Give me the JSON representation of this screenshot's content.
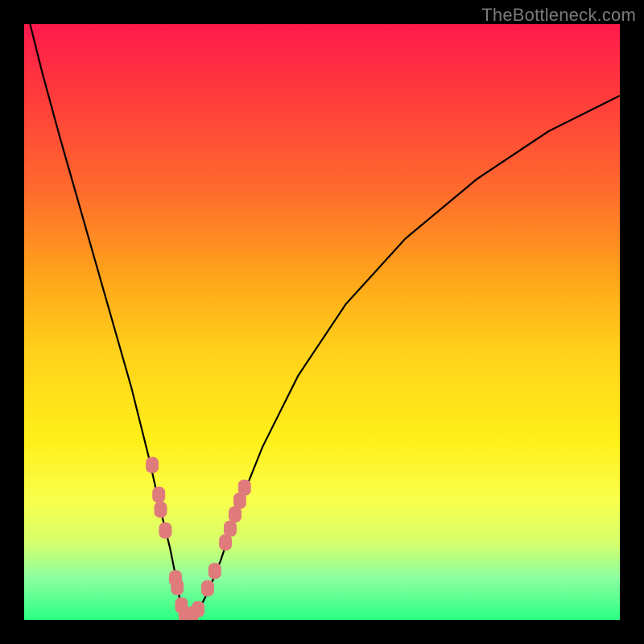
{
  "watermark": "TheBottleneck.com",
  "colors": {
    "frame": "#000000",
    "gradient_top": "#ff1a4d",
    "gradient_bottom": "#2bff84",
    "curve": "#000000",
    "marker": "#df7b7b"
  },
  "chart_data": {
    "type": "line",
    "title": "",
    "xlabel": "",
    "ylabel": "",
    "xlim": [
      0,
      100
    ],
    "ylim": [
      0,
      100
    ],
    "series": [
      {
        "name": "bottleneck-curve",
        "x": [
          1,
          3,
          6,
          10,
          14,
          18,
          21,
          23,
          24.5,
          25.5,
          26.2,
          27,
          28,
          29.5,
          31,
          33,
          36,
          40,
          46,
          54,
          64,
          76,
          88,
          100
        ],
        "y": [
          100,
          92,
          81,
          67,
          53,
          39,
          27,
          18,
          12,
          7,
          3,
          0.8,
          0.6,
          2,
          5,
          10,
          19,
          29,
          41,
          53,
          64,
          74,
          82,
          88
        ]
      }
    ],
    "markers": [
      {
        "x": 21.5,
        "y": 26
      },
      {
        "x": 22.6,
        "y": 21
      },
      {
        "x": 22.9,
        "y": 18.5
      },
      {
        "x": 23.7,
        "y": 15
      },
      {
        "x": 25.4,
        "y": 7
      },
      {
        "x": 25.7,
        "y": 5.5
      },
      {
        "x": 26.4,
        "y": 2.4
      },
      {
        "x": 27.0,
        "y": 0.9
      },
      {
        "x": 28.2,
        "y": 0.9
      },
      {
        "x": 29.2,
        "y": 1.8
      },
      {
        "x": 30.8,
        "y": 5.3
      },
      {
        "x": 32.0,
        "y": 8.2
      },
      {
        "x": 33.8,
        "y": 13
      },
      {
        "x": 34.6,
        "y": 15.3
      },
      {
        "x": 35.4,
        "y": 17.7
      },
      {
        "x": 36.2,
        "y": 20
      },
      {
        "x": 37.0,
        "y": 22.2
      }
    ]
  }
}
